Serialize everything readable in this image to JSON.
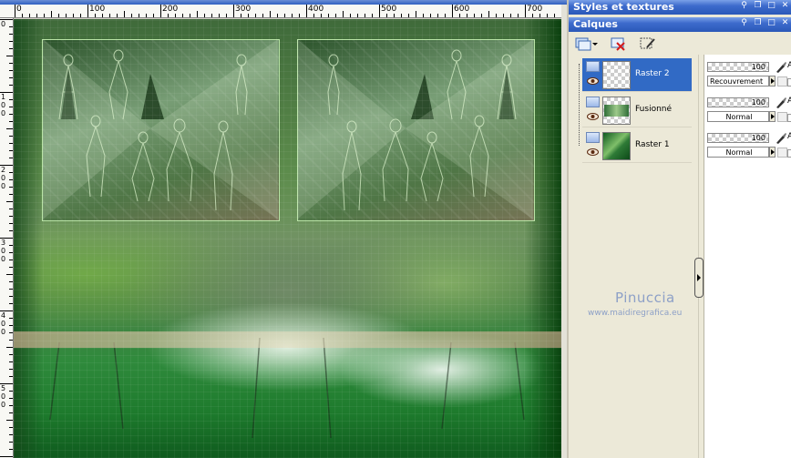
{
  "ruler": {
    "top_labels": [
      "0",
      "100",
      "200",
      "300",
      "400",
      "500",
      "600",
      "700"
    ],
    "left_labels": [
      "0",
      "1\n0\n0",
      "2\n0\n0",
      "3\n0\n0",
      "4\n0\n0",
      "5\n0\n0"
    ]
  },
  "panels": {
    "styles_title": "Styles et textures",
    "layers_title": "Calques",
    "titlebar_icons": [
      "pin-icon",
      "restore-icon",
      "maximize-icon",
      "close-icon"
    ]
  },
  "layer_toolbar": {
    "icons": [
      "new-raster-layer-icon",
      "dropdown-arrow-icon",
      "delete-layer-icon",
      "edit-mask-icon"
    ]
  },
  "layers": [
    {
      "name": "Raster 2",
      "selected": true,
      "opacity": "100",
      "blend_mode": "Recouvrement",
      "lock_letter": "A"
    },
    {
      "name": "Fusionné",
      "selected": false,
      "opacity": "100",
      "blend_mode": "Normal",
      "lock_letter": "A"
    },
    {
      "name": "Raster 1",
      "selected": false,
      "opacity": "100",
      "blend_mode": "Normal",
      "lock_letter": "A"
    }
  ],
  "watermark": {
    "name": "Pinuccia",
    "url": "www.maidiregrafica.eu"
  },
  "colors": {
    "titlebar": "#2a58b8",
    "selection": "#316ac5",
    "panel_bg": "#ece9d8",
    "watermark": "#8da0c7"
  }
}
